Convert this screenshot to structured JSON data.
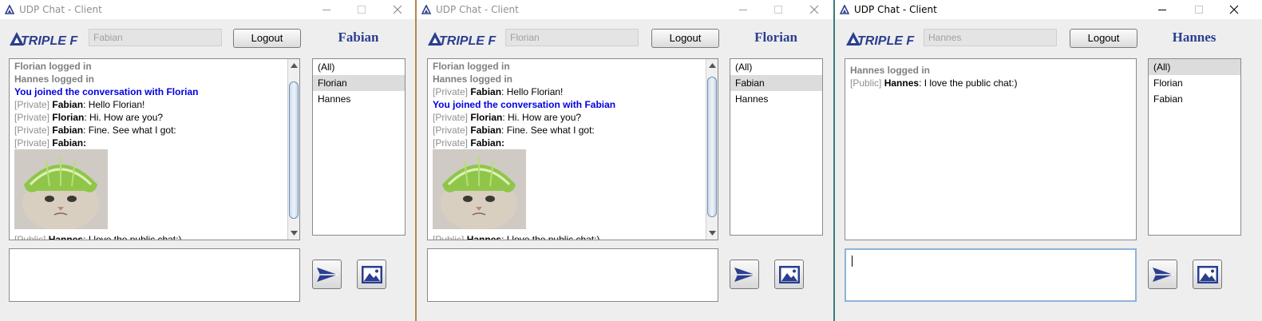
{
  "windows": [
    {
      "title": "UDP Chat - Client",
      "brand": "TRIPLE F",
      "username_field": "Fabian",
      "logout_label": "Logout",
      "user_name": "Fabian",
      "chat": {
        "line1": "Florian logged in",
        "line2": "Hannes logged in",
        "line3": "You joined the conversation with Florian",
        "line4_tag": "[Private]",
        "line4_who": "Fabian",
        "line4_text": ": Hello Florian!",
        "line5_tag": "[Private]",
        "line5_who": "Florian",
        "line5_text": ": Hi. How are you?",
        "line6_tag": "[Private]",
        "line6_who": "Fabian",
        "line6_text": ": Fine. See what I got:",
        "line7_tag": "[Private]",
        "line7_who": "Fabian:",
        "line8_tag": "[Public]",
        "line8_who": "Hannes",
        "line8_text": ": I love the public chat:)"
      },
      "users": [
        "(All)",
        "Florian",
        "Hannes"
      ],
      "selected_user": "Florian"
    },
    {
      "title": "UDP Chat - Client",
      "brand": "TRIPLE F",
      "username_field": "Florian",
      "logout_label": "Logout",
      "user_name": "Florian",
      "chat": {
        "line1": "Florian logged in",
        "line2": "Hannes logged in",
        "line3_tag": "[Private]",
        "line3_who": "Fabian",
        "line3_text": ": Hello Florian!",
        "line4": "You joined the conversation with Fabian",
        "line5_tag": "[Private]",
        "line5_who": "Florian",
        "line5_text": ": Hi. How are you?",
        "line6_tag": "[Private]",
        "line6_who": "Fabian",
        "line6_text": ": Fine. See what I got:",
        "line7_tag": "[Private]",
        "line7_who": "Fabian:",
        "line8_tag": "[Public]",
        "line8_who": "Hannes",
        "line8_text": ": I love the public chat:)"
      },
      "users": [
        "(All)",
        "Fabian",
        "Hannes"
      ],
      "selected_user": "Fabian"
    },
    {
      "title": "UDP Chat - Client",
      "brand": "TRIPLE F",
      "username_field": "Hannes",
      "logout_label": "Logout",
      "user_name": "Hannes",
      "chat": {
        "line1": "Hannes logged in",
        "line2_tag": "[Public]",
        "line2_who": "Hannes",
        "line2_text": ": I love the public chat:)"
      },
      "users": [
        "(All)",
        "Florian",
        "Fabian"
      ],
      "selected_user": "(All)"
    }
  ],
  "icons": {
    "app": "triple-f-logo-icon",
    "send": "send-arrow-icon",
    "image": "picture-icon",
    "minimize": "minimize-icon",
    "maximize": "maximize-icon",
    "close": "close-icon"
  },
  "colors": {
    "brand_blue": "#2b3f8e",
    "join_blue": "#0000e0",
    "system_gray": "#808080"
  }
}
